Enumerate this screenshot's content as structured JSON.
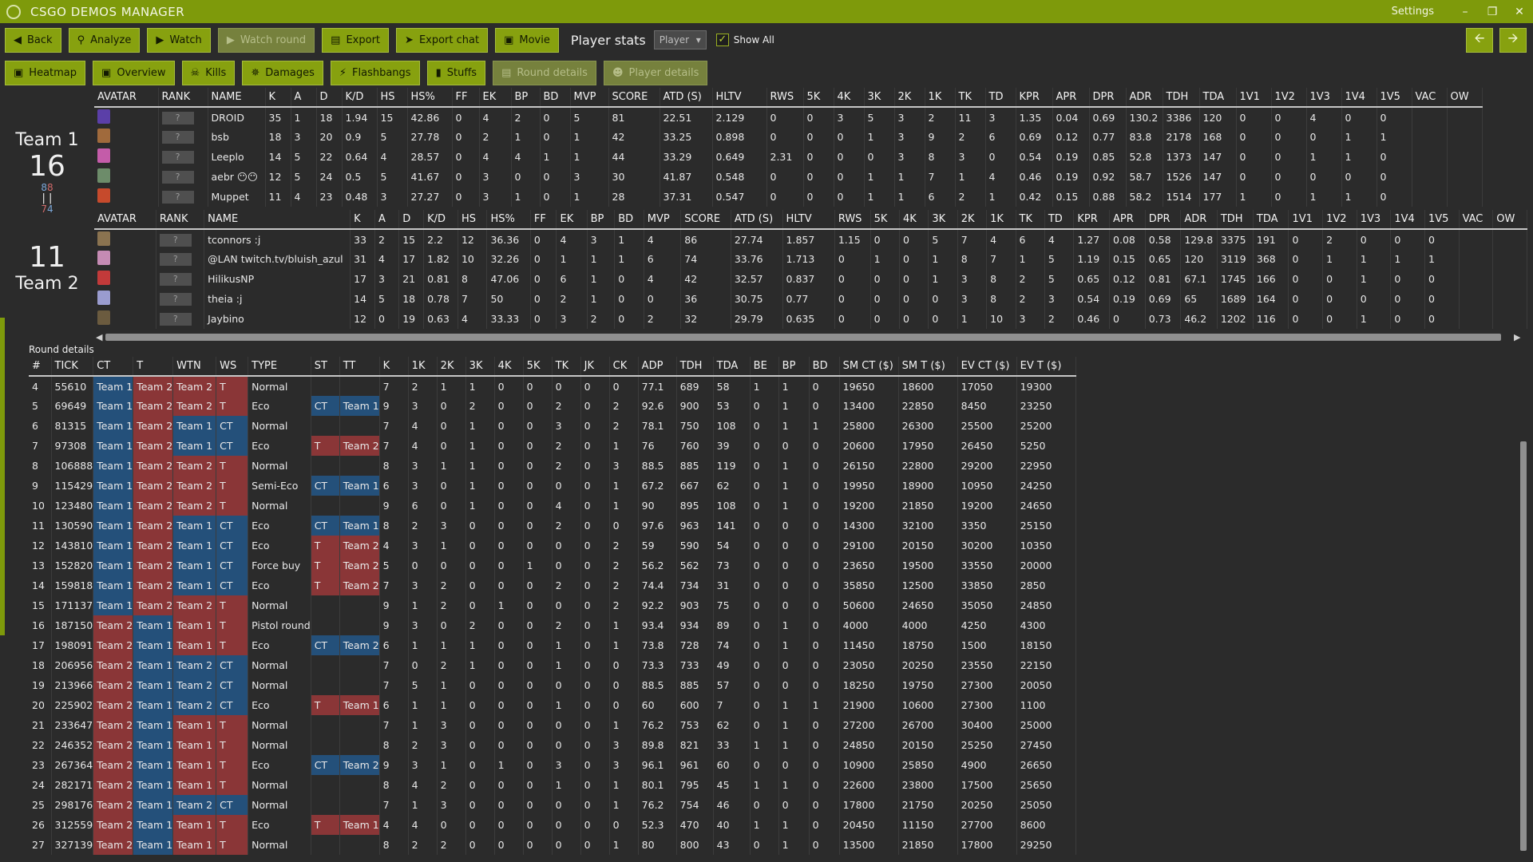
{
  "app": {
    "title": "CSGO DEMOS MANAGER",
    "settings": "Settings"
  },
  "toolbar1": {
    "back": "Back",
    "analyze": "Analyze",
    "watch": "Watch",
    "watch_round": "Watch round",
    "export": "Export",
    "export_chat": "Export chat",
    "movie": "Movie",
    "player_stats": "Player stats",
    "player_combo": "Player",
    "show_all": "Show All"
  },
  "toolbar2": {
    "heatmap": "Heatmap",
    "overview": "Overview",
    "kills": "Kills",
    "damages": "Damages",
    "flashbangs": "Flashbangs",
    "stuffs": "Stuffs",
    "round_details": "Round details",
    "player_details": "Player details"
  },
  "team1": {
    "name": "Team 1",
    "score": "16",
    "wins_ct": "8",
    "wins_t": "8",
    "losses_ct": "7",
    "losses_t": "4"
  },
  "team2": {
    "name": "Team 2",
    "score": "11"
  },
  "player_headers": [
    "AVATAR",
    "RANK",
    "NAME",
    "K",
    "A",
    "D",
    "K/D",
    "HS",
    "HS%",
    "FF",
    "EK",
    "BP",
    "BD",
    "MVP",
    "SCORE",
    "ATD (S)",
    "HLTV",
    "RWS",
    "5K",
    "4K",
    "3K",
    "2K",
    "1K",
    "TK",
    "TD",
    "KPR",
    "APR",
    "DPR",
    "ADR",
    "TDH",
    "TDA",
    "1V1",
    "1V2",
    "1V3",
    "1V4",
    "1V5",
    "VAC",
    "OW"
  ],
  "rank_placeholder": "?",
  "team1_players": [
    [
      "DROID",
      "35",
      "1",
      "18",
      "1.94",
      "15",
      "42.86",
      "0",
      "4",
      "2",
      "0",
      "5",
      "81",
      "22.51",
      "2.129",
      "0",
      "0",
      "3",
      "5",
      "3",
      "2",
      "11",
      "3",
      "1.35",
      "0.04",
      "0.69",
      "130.2",
      "3386",
      "120",
      "0",
      "0",
      "4",
      "0",
      "0",
      "",
      ""
    ],
    [
      "bsb",
      "18",
      "3",
      "20",
      "0.9",
      "5",
      "27.78",
      "0",
      "2",
      "1",
      "0",
      "1",
      "42",
      "33.25",
      "0.898",
      "0",
      "0",
      "0",
      "1",
      "3",
      "9",
      "2",
      "6",
      "0.69",
      "0.12",
      "0.77",
      "83.8",
      "2178",
      "168",
      "0",
      "0",
      "0",
      "1",
      "1",
      "",
      ""
    ],
    [
      "Leeplo",
      "14",
      "5",
      "22",
      "0.64",
      "4",
      "28.57",
      "0",
      "4",
      "4",
      "1",
      "1",
      "44",
      "33.29",
      "0.649",
      "2.31",
      "0",
      "0",
      "0",
      "3",
      "8",
      "3",
      "0",
      "0.54",
      "0.19",
      "0.85",
      "52.8",
      "1373",
      "147",
      "0",
      "0",
      "1",
      "1",
      "0",
      "",
      ""
    ],
    [
      "aebr 😶😶",
      "12",
      "5",
      "24",
      "0.5",
      "5",
      "41.67",
      "0",
      "3",
      "0",
      "0",
      "3",
      "30",
      "41.87",
      "0.548",
      "0",
      "0",
      "0",
      "1",
      "1",
      "7",
      "1",
      "4",
      "0.46",
      "0.19",
      "0.92",
      "58.7",
      "1526",
      "147",
      "0",
      "0",
      "0",
      "0",
      "0",
      "",
      ""
    ],
    [
      "Muppet",
      "11",
      "4",
      "23",
      "0.48",
      "3",
      "27.27",
      "0",
      "3",
      "1",
      "0",
      "1",
      "28",
      "37.31",
      "0.547",
      "0",
      "0",
      "0",
      "1",
      "1",
      "6",
      "2",
      "1",
      "0.42",
      "0.15",
      "0.88",
      "58.2",
      "1514",
      "177",
      "1",
      "0",
      "1",
      "1",
      "0",
      "",
      ""
    ]
  ],
  "team2_players": [
    [
      "tconnors :j",
      "33",
      "2",
      "15",
      "2.2",
      "12",
      "36.36",
      "0",
      "4",
      "3",
      "1",
      "4",
      "86",
      "27.74",
      "1.857",
      "1.15",
      "0",
      "0",
      "5",
      "7",
      "4",
      "6",
      "4",
      "1.27",
      "0.08",
      "0.58",
      "129.8",
      "3375",
      "191",
      "0",
      "2",
      "0",
      "0",
      "0",
      "",
      ""
    ],
    [
      "@LAN twitch.tv/bluish_azul",
      "31",
      "4",
      "17",
      "1.82",
      "10",
      "32.26",
      "0",
      "1",
      "1",
      "1",
      "6",
      "74",
      "33.76",
      "1.713",
      "0",
      "1",
      "0",
      "1",
      "8",
      "7",
      "1",
      "5",
      "1.19",
      "0.15",
      "0.65",
      "120",
      "3119",
      "368",
      "0",
      "1",
      "1",
      "1",
      "1",
      "",
      ""
    ],
    [
      "HilikusNP",
      "17",
      "3",
      "21",
      "0.81",
      "8",
      "47.06",
      "0",
      "6",
      "1",
      "0",
      "4",
      "42",
      "32.57",
      "0.837",
      "0",
      "0",
      "0",
      "1",
      "3",
      "8",
      "2",
      "5",
      "0.65",
      "0.12",
      "0.81",
      "67.1",
      "1745",
      "166",
      "0",
      "0",
      "1",
      "0",
      "0",
      "",
      ""
    ],
    [
      "theia :j",
      "14",
      "5",
      "18",
      "0.78",
      "7",
      "50",
      "0",
      "2",
      "1",
      "0",
      "0",
      "36",
      "30.75",
      "0.77",
      "0",
      "0",
      "0",
      "0",
      "3",
      "8",
      "2",
      "3",
      "0.54",
      "0.19",
      "0.69",
      "65",
      "1689",
      "164",
      "0",
      "0",
      "0",
      "0",
      "0",
      "",
      ""
    ],
    [
      "Jaybino",
      "12",
      "0",
      "19",
      "0.63",
      "4",
      "33.33",
      "0",
      "3",
      "2",
      "0",
      "2",
      "32",
      "29.79",
      "0.635",
      "0",
      "0",
      "0",
      "0",
      "1",
      "10",
      "3",
      "2",
      "0.46",
      "0",
      "0.73",
      "46.2",
      "1202",
      "116",
      "0",
      "0",
      "1",
      "0",
      "0",
      "",
      ""
    ]
  ],
  "avatar_colors_t1": [
    "#5b3fa8",
    "#a06a3c",
    "#c45ca9",
    "#6d8c6a",
    "#c64a2c"
  ],
  "avatar_colors_t2": [
    "#8a7350",
    "#c58bb4",
    "#c23a3a",
    "#9a9ccf",
    "#6b5b3f"
  ],
  "round_details_label": "Round details",
  "round_headers": [
    "#",
    "TICK",
    "CT",
    "T",
    "WTN",
    "WS",
    "TYPE",
    "ST",
    "TT",
    "K",
    "1K",
    "2K",
    "3K",
    "4K",
    "5K",
    "TK",
    "JK",
    "CK",
    "ADP",
    "TDH",
    "TDA",
    "BE",
    "BP",
    "BD",
    "SM CT ($)",
    "SM T ($)",
    "EV CT ($)",
    "EV T ($)"
  ],
  "rounds": [
    [
      "4",
      "55610",
      "Team 1",
      "Team 2",
      "Team 2",
      "T",
      "Normal",
      "",
      "",
      "7",
      "2",
      "1",
      "1",
      "0",
      "0",
      "0",
      "0",
      "0",
      "77.1",
      "689",
      "58",
      "1",
      "1",
      "0",
      "19650",
      "18600",
      "17050",
      "19300"
    ],
    [
      "5",
      "69649",
      "Team 1",
      "Team 2",
      "Team 2",
      "T",
      "Eco",
      "CT",
      "Team 1",
      "9",
      "3",
      "0",
      "2",
      "0",
      "0",
      "2",
      "0",
      "2",
      "92.6",
      "900",
      "53",
      "0",
      "1",
      "0",
      "13400",
      "22850",
      "8450",
      "23250"
    ],
    [
      "6",
      "81315",
      "Team 1",
      "Team 2",
      "Team 1",
      "CT",
      "Normal",
      "",
      "",
      "7",
      "4",
      "0",
      "1",
      "0",
      "0",
      "3",
      "0",
      "2",
      "78.1",
      "750",
      "108",
      "0",
      "1",
      "1",
      "25800",
      "26300",
      "25500",
      "25200"
    ],
    [
      "7",
      "97308",
      "Team 1",
      "Team 2",
      "Team 1",
      "CT",
      "Eco",
      "T",
      "Team 2",
      "7",
      "4",
      "0",
      "1",
      "0",
      "0",
      "2",
      "0",
      "1",
      "76",
      "760",
      "39",
      "0",
      "0",
      "0",
      "20600",
      "17950",
      "26450",
      "5250"
    ],
    [
      "8",
      "106888",
      "Team 1",
      "Team 2",
      "Team 2",
      "T",
      "Normal",
      "",
      "",
      "8",
      "3",
      "1",
      "1",
      "0",
      "0",
      "2",
      "0",
      "3",
      "88.5",
      "885",
      "119",
      "0",
      "1",
      "0",
      "26150",
      "22800",
      "29200",
      "22950"
    ],
    [
      "9",
      "115429",
      "Team 1",
      "Team 2",
      "Team 2",
      "T",
      "Semi-Eco",
      "CT",
      "Team 1",
      "6",
      "3",
      "0",
      "1",
      "0",
      "0",
      "0",
      "0",
      "1",
      "67.2",
      "667",
      "62",
      "0",
      "1",
      "0",
      "19950",
      "18900",
      "10950",
      "24250"
    ],
    [
      "10",
      "123480",
      "Team 1",
      "Team 2",
      "Team 2",
      "T",
      "Normal",
      "",
      "",
      "9",
      "6",
      "0",
      "1",
      "0",
      "0",
      "4",
      "0",
      "1",
      "90",
      "895",
      "108",
      "0",
      "1",
      "0",
      "19200",
      "21850",
      "19200",
      "24650"
    ],
    [
      "11",
      "130590",
      "Team 1",
      "Team 2",
      "Team 1",
      "CT",
      "Eco",
      "CT",
      "Team 1",
      "8",
      "2",
      "3",
      "0",
      "0",
      "0",
      "2",
      "0",
      "0",
      "97.6",
      "963",
      "141",
      "0",
      "0",
      "0",
      "14300",
      "32100",
      "3350",
      "25150"
    ],
    [
      "12",
      "143810",
      "Team 1",
      "Team 2",
      "Team 1",
      "CT",
      "Eco",
      "T",
      "Team 2",
      "4",
      "3",
      "1",
      "0",
      "0",
      "0",
      "0",
      "0",
      "2",
      "59",
      "590",
      "54",
      "0",
      "0",
      "0",
      "29100",
      "20150",
      "30200",
      "10350"
    ],
    [
      "13",
      "152820",
      "Team 1",
      "Team 2",
      "Team 1",
      "CT",
      "Force buy",
      "T",
      "Team 2",
      "5",
      "0",
      "0",
      "0",
      "0",
      "1",
      "0",
      "0",
      "2",
      "56.2",
      "562",
      "73",
      "0",
      "0",
      "0",
      "23650",
      "19500",
      "33550",
      "20000"
    ],
    [
      "14",
      "159818",
      "Team 1",
      "Team 2",
      "Team 1",
      "CT",
      "Eco",
      "T",
      "Team 2",
      "7",
      "3",
      "2",
      "0",
      "0",
      "0",
      "2",
      "0",
      "2",
      "74.4",
      "734",
      "31",
      "0",
      "0",
      "0",
      "35850",
      "12500",
      "33850",
      "2850"
    ],
    [
      "15",
      "171137",
      "Team 1",
      "Team 2",
      "Team 2",
      "T",
      "Normal",
      "",
      "",
      "9",
      "1",
      "2",
      "0",
      "1",
      "0",
      "0",
      "0",
      "2",
      "92.2",
      "903",
      "75",
      "0",
      "0",
      "0",
      "50600",
      "24650",
      "35050",
      "24850"
    ],
    [
      "16",
      "187150",
      "Team 2",
      "Team 1",
      "Team 1",
      "T",
      "Pistol round",
      "",
      "",
      "9",
      "3",
      "0",
      "2",
      "0",
      "0",
      "2",
      "0",
      "1",
      "93.4",
      "934",
      "89",
      "0",
      "1",
      "0",
      "4000",
      "4000",
      "4250",
      "4300"
    ],
    [
      "17",
      "198091",
      "Team 2",
      "Team 1",
      "Team 1",
      "T",
      "Eco",
      "CT",
      "Team 2",
      "6",
      "1",
      "1",
      "1",
      "0",
      "0",
      "1",
      "0",
      "1",
      "73.8",
      "728",
      "74",
      "0",
      "1",
      "0",
      "11450",
      "18750",
      "1500",
      "18150"
    ],
    [
      "18",
      "206956",
      "Team 2",
      "Team 1",
      "Team 2",
      "CT",
      "Normal",
      "",
      "",
      "7",
      "0",
      "2",
      "1",
      "0",
      "0",
      "1",
      "0",
      "0",
      "73.3",
      "733",
      "49",
      "0",
      "0",
      "0",
      "23050",
      "20250",
      "23550",
      "22150"
    ],
    [
      "19",
      "213966",
      "Team 2",
      "Team 1",
      "Team 2",
      "CT",
      "Normal",
      "",
      "",
      "7",
      "5",
      "1",
      "0",
      "0",
      "0",
      "0",
      "0",
      "0",
      "88.5",
      "885",
      "57",
      "0",
      "0",
      "0",
      "18250",
      "19750",
      "27300",
      "20050"
    ],
    [
      "20",
      "225902",
      "Team 2",
      "Team 1",
      "Team 2",
      "CT",
      "Eco",
      "T",
      "Team 1",
      "6",
      "1",
      "1",
      "0",
      "0",
      "0",
      "1",
      "0",
      "0",
      "60",
      "600",
      "7",
      "0",
      "1",
      "1",
      "21900",
      "10600",
      "27300",
      "1100"
    ],
    [
      "21",
      "233647",
      "Team 2",
      "Team 1",
      "Team 1",
      "T",
      "Normal",
      "",
      "",
      "7",
      "1",
      "3",
      "0",
      "0",
      "0",
      "0",
      "0",
      "1",
      "76.2",
      "753",
      "62",
      "0",
      "1",
      "0",
      "27200",
      "26700",
      "30400",
      "25000"
    ],
    [
      "22",
      "246352",
      "Team 2",
      "Team 1",
      "Team 1",
      "T",
      "Normal",
      "",
      "",
      "8",
      "2",
      "3",
      "0",
      "0",
      "0",
      "0",
      "0",
      "3",
      "89.8",
      "821",
      "33",
      "1",
      "1",
      "0",
      "24850",
      "20150",
      "25250",
      "27450"
    ],
    [
      "23",
      "267364",
      "Team 2",
      "Team 1",
      "Team 1",
      "T",
      "Eco",
      "CT",
      "Team 2",
      "9",
      "3",
      "1",
      "0",
      "1",
      "0",
      "3",
      "0",
      "3",
      "96.1",
      "961",
      "60",
      "0",
      "0",
      "0",
      "10900",
      "25850",
      "4900",
      "26650"
    ],
    [
      "24",
      "282171",
      "Team 2",
      "Team 1",
      "Team 1",
      "T",
      "Normal",
      "",
      "",
      "8",
      "4",
      "2",
      "0",
      "0",
      "0",
      "1",
      "0",
      "1",
      "80.1",
      "795",
      "45",
      "1",
      "1",
      "0",
      "22600",
      "23800",
      "17500",
      "25650"
    ],
    [
      "25",
      "298176",
      "Team 2",
      "Team 1",
      "Team 2",
      "CT",
      "Normal",
      "",
      "",
      "7",
      "1",
      "3",
      "0",
      "0",
      "0",
      "0",
      "0",
      "1",
      "76.2",
      "754",
      "46",
      "0",
      "0",
      "0",
      "17800",
      "21750",
      "20250",
      "25050"
    ],
    [
      "26",
      "312559",
      "Team 2",
      "Team 1",
      "Team 1",
      "T",
      "Eco",
      "T",
      "Team 1",
      "4",
      "4",
      "0",
      "0",
      "0",
      "0",
      "0",
      "0",
      "0",
      "52.3",
      "470",
      "40",
      "1",
      "1",
      "0",
      "20450",
      "11150",
      "27700",
      "8600"
    ],
    [
      "27",
      "327139",
      "Team 2",
      "Team 1",
      "Team 1",
      "T",
      "Normal",
      "",
      "",
      "8",
      "2",
      "2",
      "0",
      "0",
      "0",
      "0",
      "0",
      "1",
      "80",
      "800",
      "43",
      "0",
      "1",
      "0",
      "13500",
      "21850",
      "17800",
      "29250"
    ]
  ],
  "colors": {
    "accent": "#7e9a0b",
    "ct": "#24507a",
    "t": "#8a3637"
  }
}
